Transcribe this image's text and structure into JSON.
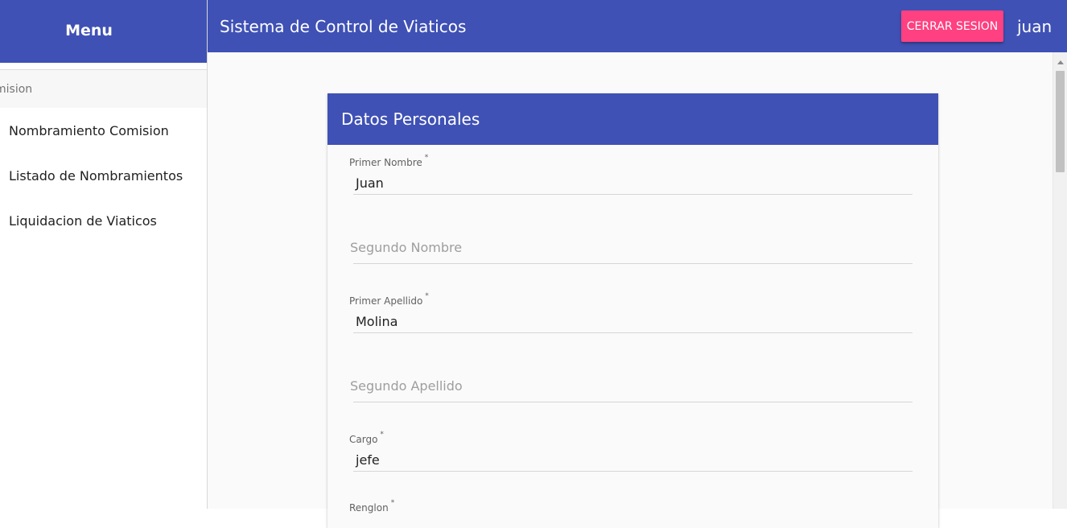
{
  "sidebar": {
    "title": "Menu",
    "sub": "mision",
    "items": [
      {
        "label": "Nombramiento Comision"
      },
      {
        "label": "Listado de Nombramientos"
      },
      {
        "label": "Liquidacion de Viaticos"
      }
    ]
  },
  "appbar": {
    "title": "Sistema de Control de Viaticos",
    "logout_label": "CERRAR SESION",
    "user": "juan"
  },
  "form": {
    "title": "Datos Personales",
    "required_mark": "*",
    "primer_nombre": {
      "label": "Primer Nombre",
      "value": "Juan"
    },
    "segundo_nombre": {
      "placeholder": "Segundo Nombre"
    },
    "primer_apellido": {
      "label": "Primer Apellido",
      "value": "Molina"
    },
    "segundo_apellido": {
      "placeholder": "Segundo Apellido"
    },
    "cargo": {
      "label": "Cargo",
      "value": "jefe"
    },
    "renglon": {
      "label": "Renglon"
    }
  }
}
